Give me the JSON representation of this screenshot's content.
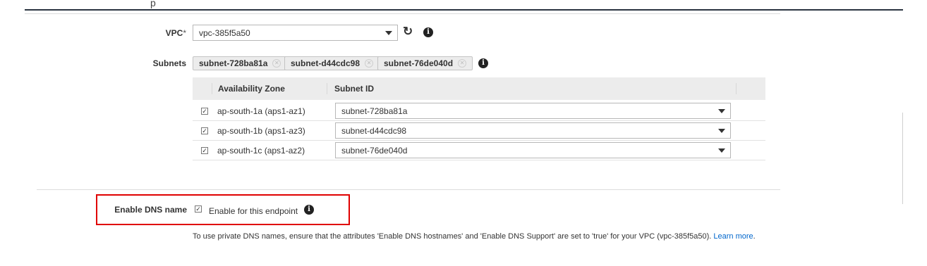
{
  "header": {
    "partial_title_glyph": "p"
  },
  "vpc": {
    "label": "VPC",
    "required_mark": "*",
    "selected": "vpc-385f5a50",
    "refresh_icon": "refresh-icon",
    "info_icon": "info-icon"
  },
  "subnets": {
    "label": "Subnets",
    "tokens": [
      {
        "label": "subnet-728ba81a"
      },
      {
        "label": "subnet-d44cdc98"
      },
      {
        "label": "subnet-76de040d"
      }
    ],
    "table": {
      "headers": {
        "az": "Availability Zone",
        "subnet": "Subnet ID"
      },
      "rows": [
        {
          "checked": true,
          "az": "ap-south-1a (aps1-az1)",
          "subnet": "subnet-728ba81a"
        },
        {
          "checked": true,
          "az": "ap-south-1b (aps1-az3)",
          "subnet": "subnet-d44cdc98"
        },
        {
          "checked": true,
          "az": "ap-south-1c (aps1-az2)",
          "subnet": "subnet-76de040d"
        }
      ]
    }
  },
  "dns": {
    "label": "Enable DNS name",
    "checked": true,
    "checkbox_label": "Enable for this endpoint",
    "note_text": "To use private DNS names, ensure that the attributes 'Enable DNS hostnames' and 'Enable DNS Support' are set to 'true' for your VPC (vpc-385f5a50).",
    "learn": "Learn",
    "more": "more",
    "period": "."
  },
  "colors": {
    "highlight": "#e00000",
    "link": "#0066cc",
    "header_bg": "#ececec"
  }
}
